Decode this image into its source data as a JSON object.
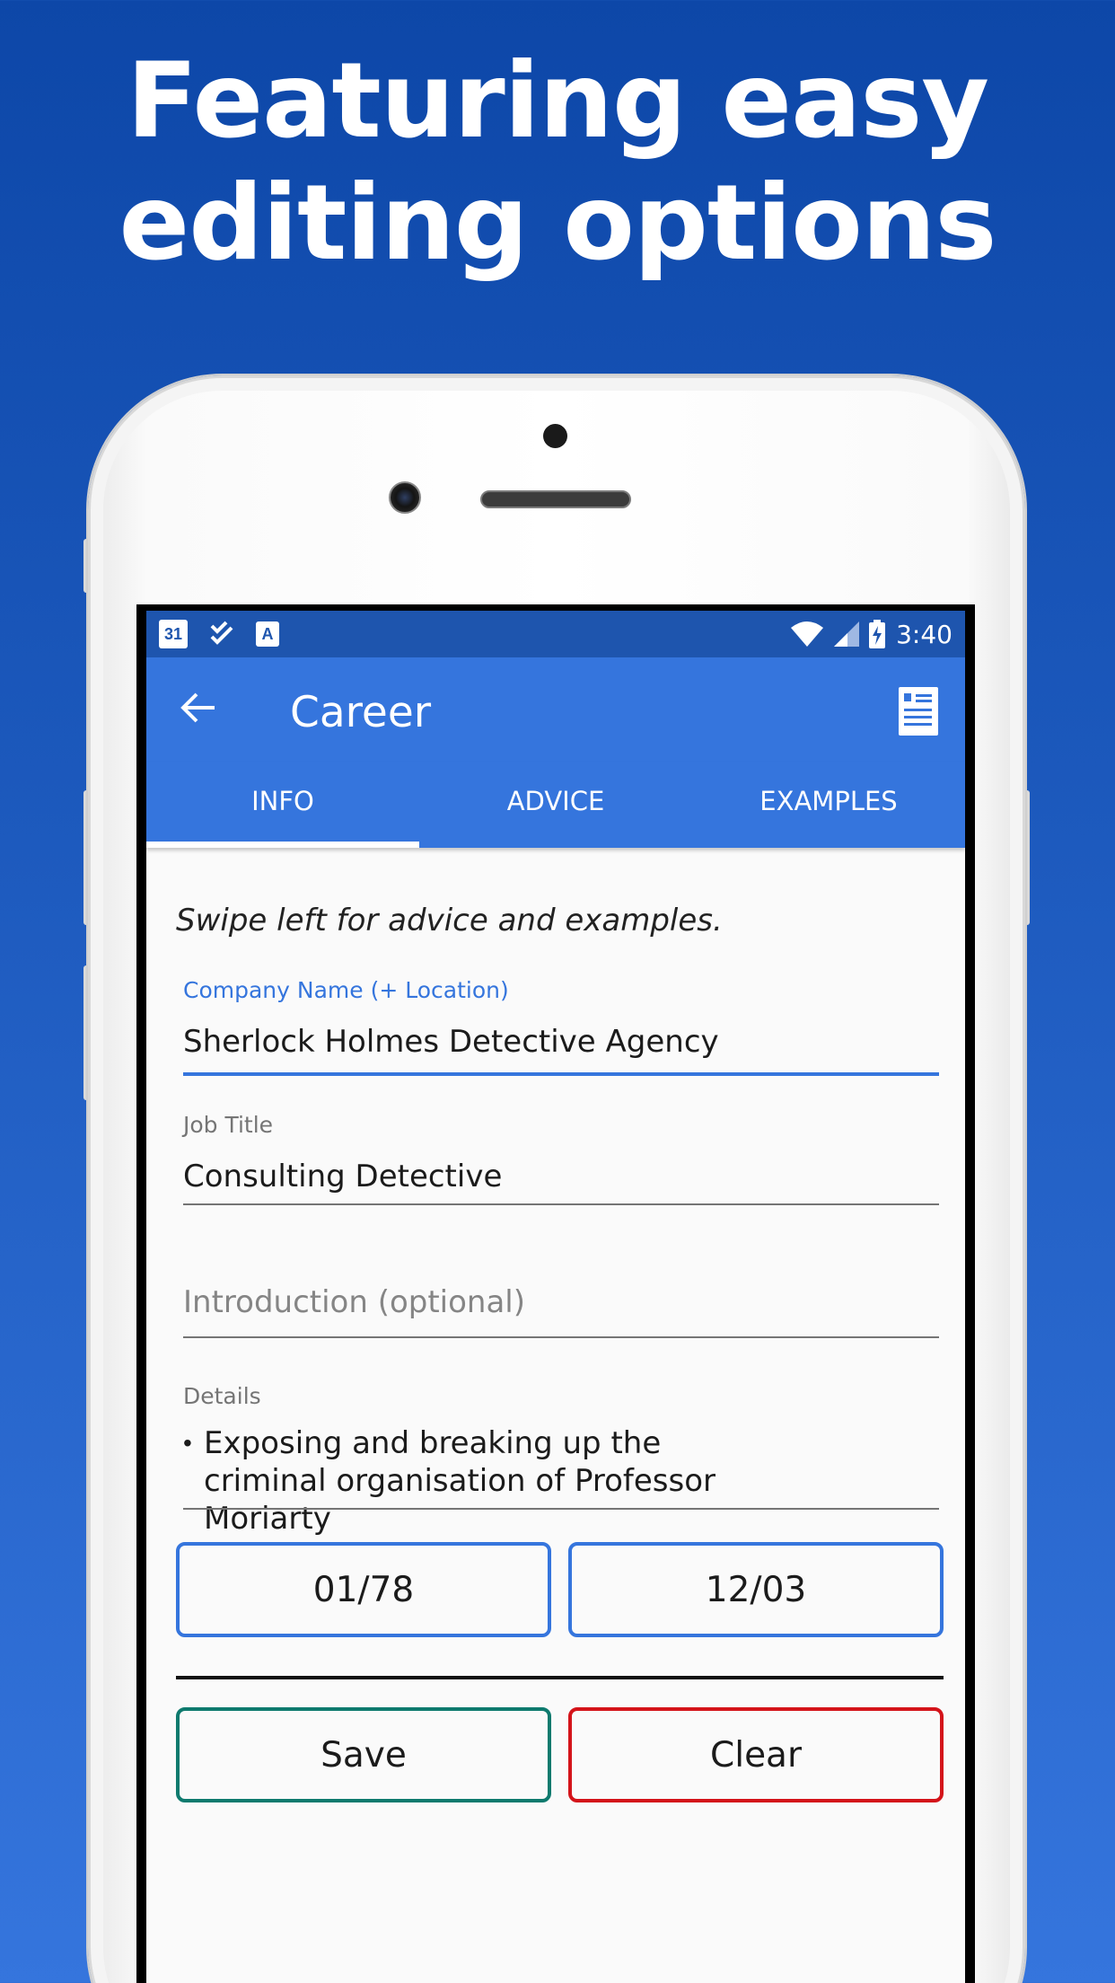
{
  "headline": {
    "line1": "Featuring easy",
    "line2": "editing options"
  },
  "status_bar": {
    "calendar_day": "31",
    "a_icon_label": "A",
    "time": "3:40",
    "icons": [
      "calendar-icon",
      "tasks-check-icon",
      "translate-a-icon",
      "wifi-icon",
      "signal-icon",
      "battery-charging-icon"
    ]
  },
  "app_bar": {
    "title": "Career",
    "back_icon": "arrow-left-icon",
    "action_icon": "resume-document-icon"
  },
  "tabs": [
    {
      "label": "INFO",
      "active": true
    },
    {
      "label": "ADVICE",
      "active": false
    },
    {
      "label": "EXAMPLES",
      "active": false
    }
  ],
  "hint": "Swipe left for advice and examples.",
  "form": {
    "company": {
      "label": "Company Name (+ Location)",
      "value": "Sherlock Holmes Detective Agency"
    },
    "job_title": {
      "label": "Job Title",
      "value": "Consulting Detective"
    },
    "introduction": {
      "placeholder": "Introduction (optional)"
    },
    "details": {
      "label": "Details",
      "bullet": "•",
      "value": "Exposing and breaking up the criminal organisation of Professor Moriarty"
    }
  },
  "dates": {
    "start": "01/78",
    "end": "12/03"
  },
  "actions": {
    "save": "Save",
    "clear": "Clear"
  },
  "colors": {
    "app_bar": "#3575dd",
    "status_bar": "#1e55ae",
    "save_border": "#0e7a6e",
    "clear_border": "#d4141a",
    "date_border": "#3575dd"
  }
}
